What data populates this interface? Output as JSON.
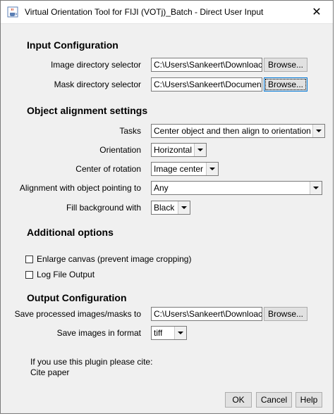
{
  "window": {
    "title": "Virtual Orientation Tool for FIJI (VOTj)_Batch - Direct User Input",
    "close_glyph": "✕"
  },
  "input_config": {
    "heading": "Input Configuration",
    "image_dir_label": "Image directory selector",
    "image_dir_value": "C:\\Users\\Sankeert\\Downloac",
    "mask_dir_label": "Mask directory selector",
    "mask_dir_value": "C:\\Users\\Sankeert\\Documen",
    "browse_label": "Browse..."
  },
  "alignment": {
    "heading": "Object alignment settings",
    "tasks_label": "Tasks",
    "tasks_value": "Center object and then align to orientation",
    "orientation_label": "Orientation",
    "orientation_value": "Horizontal",
    "center_label": "Center of rotation",
    "center_value": "Image center",
    "pointing_label": "Alignment with object pointing to",
    "pointing_value": "Any",
    "fill_label": "Fill background with",
    "fill_value": "Black"
  },
  "additional": {
    "heading": "Additional options",
    "enlarge_label": "Enlarge canvas (prevent image cropping)",
    "enlarge_checked": false,
    "log_label": "Log File Output",
    "log_checked": false
  },
  "output_config": {
    "heading": "Output Configuration",
    "save_label": "Save processed images/masks to",
    "save_value": "C:\\Users\\Sankeert\\Downloac",
    "browse_label": "Browse...",
    "format_label": "Save images in format",
    "format_value": "tiff"
  },
  "citation": {
    "line1": "If you use this plugin please cite:",
    "line2": "Cite paper"
  },
  "buttons": {
    "ok": "OK",
    "cancel": "Cancel",
    "help": "Help"
  },
  "icons": {
    "app": "java-coffee-icon",
    "close": "close-icon",
    "dropdown": "chevron-down-icon"
  }
}
